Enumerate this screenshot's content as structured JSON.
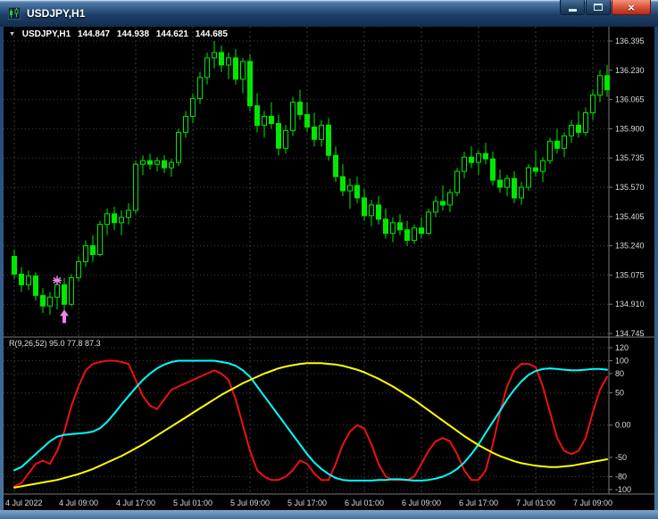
{
  "window": {
    "title": "USDJPY,H1",
    "controls": {
      "close_glyph": "×"
    }
  },
  "info_bar": {
    "dropdown_glyph": "▼",
    "symbol_period": "USDJPY,H1",
    "open": "144.847",
    "high": "144.938",
    "low": "144.621",
    "close": "144.685"
  },
  "price_axis": {
    "labels": [
      "136.395",
      "136.230",
      "136.065",
      "135.900",
      "135.735",
      "135.570",
      "135.405",
      "135.240",
      "135.075",
      "134.910",
      "134.745"
    ]
  },
  "indicator_panel": {
    "label": "R(9,26,52) 95.0 77.8 87.3",
    "axis_labels": [
      "120",
      "100",
      "80",
      "50",
      "0.00",
      "-50",
      "-80",
      "-100"
    ],
    "axis_values": [
      120,
      100,
      80,
      50,
      0,
      -50,
      -80,
      -100
    ]
  },
  "time_axis": {
    "labels": [
      "4 Jul 2022",
      "4 Jul 09:00",
      "4 Jul 17:00",
      "5 Jul 01:00",
      "5 Jul 09:00",
      "5 Jul 17:00",
      "6 Jul 01:00",
      "6 Jul 09:00",
      "6 Jul 17:00",
      "7 Jul 01:00",
      "7 Jul 09:00"
    ],
    "bar_indices": [
      0,
      9,
      17,
      25,
      33,
      41,
      49,
      57,
      65,
      73,
      81
    ]
  },
  "colors": {
    "background": "#000000",
    "grid": "#3c3c3c",
    "frame_line": "#7a7a7a",
    "axis_text": "#dcdcdc",
    "candle": "#00e800",
    "bull_fill": "#000000",
    "indicator_red": "#ee1111",
    "indicator_cyan": "#00ffff",
    "indicator_yellow": "#ffff00",
    "marker": "#ee82ee"
  },
  "chart_data": {
    "type": "candlestick",
    "title": "USDJPY,H1",
    "ylim": [
      134.7,
      136.44
    ],
    "price_gridlines": [
      136.395,
      136.23,
      136.065,
      135.9,
      135.735,
      135.57,
      135.405,
      135.24,
      135.075,
      134.91,
      134.745
    ],
    "candles_ohlc": [
      [
        135.18,
        135.22,
        135.05,
        135.08
      ],
      [
        135.08,
        135.12,
        134.98,
        135.02
      ],
      [
        135.02,
        135.1,
        134.99,
        135.07
      ],
      [
        135.07,
        135.09,
        134.93,
        134.96
      ],
      [
        134.96,
        135.0,
        134.86,
        134.9
      ],
      [
        134.9,
        134.98,
        134.85,
        134.95
      ],
      [
        134.95,
        135.05,
        134.88,
        135.02
      ],
      [
        135.02,
        135.06,
        134.87,
        134.91
      ],
      [
        134.91,
        135.08,
        134.9,
        135.06
      ],
      [
        135.06,
        135.18,
        135.04,
        135.15
      ],
      [
        135.15,
        135.27,
        135.12,
        135.24
      ],
      [
        135.24,
        135.3,
        135.15,
        135.19
      ],
      [
        135.19,
        135.38,
        135.18,
        135.36
      ],
      [
        135.36,
        135.45,
        135.3,
        135.42
      ],
      [
        135.42,
        135.46,
        135.33,
        135.37
      ],
      [
        135.37,
        135.44,
        135.3,
        135.4
      ],
      [
        135.4,
        135.48,
        135.36,
        135.44
      ],
      [
        135.44,
        135.72,
        135.42,
        135.7
      ],
      [
        135.7,
        135.75,
        135.64,
        135.72
      ],
      [
        135.72,
        135.76,
        135.67,
        135.7
      ],
      [
        135.7,
        135.74,
        135.66,
        135.72
      ],
      [
        135.72,
        135.75,
        135.65,
        135.68
      ],
      [
        135.68,
        135.73,
        135.63,
        135.71
      ],
      [
        135.71,
        135.9,
        135.69,
        135.88
      ],
      [
        135.88,
        136.0,
        135.85,
        135.97
      ],
      [
        135.97,
        136.1,
        135.93,
        136.07
      ],
      [
        136.07,
        136.22,
        136.04,
        136.19
      ],
      [
        136.19,
        136.33,
        136.15,
        136.3
      ],
      [
        136.3,
        136.395,
        136.24,
        136.33
      ],
      [
        136.33,
        136.37,
        136.22,
        136.26
      ],
      [
        136.26,
        136.33,
        136.18,
        136.3
      ],
      [
        136.3,
        136.35,
        136.15,
        136.18
      ],
      [
        136.18,
        136.3,
        136.1,
        136.28
      ],
      [
        136.28,
        136.32,
        136.0,
        136.03
      ],
      [
        136.03,
        136.1,
        135.88,
        135.92
      ],
      [
        135.92,
        136.0,
        135.85,
        135.97
      ],
      [
        135.97,
        136.05,
        135.9,
        135.93
      ],
      [
        135.93,
        135.98,
        135.75,
        135.79
      ],
      [
        135.79,
        135.92,
        135.76,
        135.89
      ],
      [
        135.89,
        136.08,
        135.86,
        136.05
      ],
      [
        136.05,
        136.12,
        135.95,
        135.98
      ],
      [
        135.98,
        136.05,
        135.88,
        135.91
      ],
      [
        135.91,
        135.99,
        135.8,
        135.84
      ],
      [
        135.84,
        135.95,
        135.8,
        135.92
      ],
      [
        135.92,
        135.96,
        135.72,
        135.75
      ],
      [
        135.75,
        135.8,
        135.6,
        135.63
      ],
      [
        135.63,
        135.7,
        135.52,
        135.55
      ],
      [
        135.55,
        135.62,
        135.45,
        135.58
      ],
      [
        135.58,
        135.63,
        135.48,
        135.51
      ],
      [
        135.51,
        135.56,
        135.38,
        135.41
      ],
      [
        135.41,
        135.5,
        135.35,
        135.47
      ],
      [
        135.47,
        135.52,
        135.36,
        135.39
      ],
      [
        135.39,
        135.45,
        135.28,
        135.31
      ],
      [
        135.31,
        135.4,
        135.26,
        135.37
      ],
      [
        135.37,
        135.42,
        135.3,
        135.33
      ],
      [
        135.33,
        135.38,
        135.24,
        135.27
      ],
      [
        135.27,
        135.36,
        135.25,
        135.34
      ],
      [
        135.34,
        135.4,
        135.28,
        135.31
      ],
      [
        135.31,
        135.45,
        135.3,
        135.43
      ],
      [
        135.43,
        135.52,
        135.4,
        135.49
      ],
      [
        135.49,
        135.58,
        135.44,
        135.47
      ],
      [
        135.47,
        135.56,
        135.43,
        135.54
      ],
      [
        135.54,
        135.68,
        135.52,
        135.66
      ],
      [
        135.66,
        135.77,
        135.62,
        135.74
      ],
      [
        135.74,
        135.8,
        135.68,
        135.71
      ],
      [
        135.71,
        135.78,
        135.64,
        135.76
      ],
      [
        135.76,
        135.82,
        135.7,
        135.73
      ],
      [
        135.73,
        135.77,
        135.58,
        135.61
      ],
      [
        135.61,
        135.67,
        135.54,
        135.57
      ],
      [
        135.57,
        135.64,
        135.52,
        135.62
      ],
      [
        135.62,
        135.66,
        135.48,
        135.51
      ],
      [
        135.51,
        135.6,
        135.47,
        135.57
      ],
      [
        135.57,
        135.7,
        135.55,
        135.68
      ],
      [
        135.68,
        135.78,
        135.63,
        135.66
      ],
      [
        135.66,
        135.74,
        135.6,
        135.72
      ],
      [
        135.72,
        135.85,
        135.7,
        135.83
      ],
      [
        135.83,
        135.9,
        135.76,
        135.79
      ],
      [
        135.79,
        135.88,
        135.74,
        135.86
      ],
      [
        135.86,
        135.95,
        135.82,
        135.92
      ],
      [
        135.92,
        136.0,
        135.85,
        135.88
      ],
      [
        135.88,
        136.02,
        135.86,
        135.99
      ],
      [
        135.99,
        136.12,
        135.95,
        136.09
      ],
      [
        136.09,
        136.23,
        136.05,
        136.2
      ],
      [
        136.2,
        136.26,
        136.08,
        136.12
      ]
    ],
    "markers": [
      {
        "type": "star",
        "bar": 6,
        "price": 135.045
      },
      {
        "type": "arrow-up",
        "bar": 7,
        "price": 134.9
      }
    ],
    "indicator": {
      "name": "R(9,26,52)",
      "values_display": [
        "95.0",
        "77.8",
        "87.3"
      ],
      "range": [
        -100,
        120
      ],
      "series": [
        {
          "name": "R9",
          "color_key": "indicator_red",
          "values": [
            -95,
            -90,
            -75,
            -60,
            -55,
            -60,
            -40,
            -10,
            30,
            60,
            85,
            95,
            98,
            100,
            100,
            98,
            95,
            70,
            45,
            30,
            25,
            40,
            55,
            60,
            65,
            70,
            75,
            80,
            85,
            80,
            70,
            40,
            0,
            -40,
            -70,
            -80,
            -85,
            -85,
            -80,
            -70,
            -55,
            -60,
            -75,
            -85,
            -85,
            -60,
            -30,
            -10,
            0,
            -5,
            -30,
            -60,
            -80,
            -85,
            -85,
            -85,
            -80,
            -60,
            -40,
            -25,
            -20,
            -25,
            -45,
            -70,
            -85,
            -85,
            -70,
            -30,
            20,
            60,
            85,
            95,
            95,
            90,
            60,
            20,
            -20,
            -40,
            -45,
            -40,
            -20,
            20,
            55,
            75
          ]
        },
        {
          "name": "R26",
          "color_key": "indicator_cyan",
          "values": [
            -70,
            -65,
            -55,
            -45,
            -35,
            -25,
            -18,
            -15,
            -14,
            -13,
            -12,
            -10,
            -5,
            5,
            18,
            32,
            45,
            58,
            70,
            80,
            88,
            94,
            98,
            100,
            100,
            100,
            100,
            100,
            100,
            98,
            96,
            92,
            85,
            75,
            60,
            45,
            30,
            15,
            0,
            -15,
            -30,
            -45,
            -58,
            -68,
            -76,
            -82,
            -85,
            -86,
            -86,
            -86,
            -86,
            -85,
            -85,
            -84,
            -84,
            -85,
            -86,
            -86,
            -85,
            -83,
            -80,
            -75,
            -68,
            -58,
            -45,
            -30,
            -12,
            5,
            22,
            40,
            55,
            68,
            78,
            84,
            87,
            88,
            87,
            86,
            85,
            85,
            86,
            87,
            87,
            86
          ]
        },
        {
          "name": "R52",
          "color_key": "indicator_yellow",
          "values": [
            -97,
            -95,
            -93,
            -91,
            -89,
            -87,
            -85,
            -82,
            -79,
            -76,
            -72,
            -68,
            -63,
            -58,
            -53,
            -48,
            -42,
            -36,
            -30,
            -23,
            -16,
            -9,
            -2,
            5,
            12,
            19,
            26,
            33,
            40,
            47,
            53,
            59,
            65,
            70,
            75,
            80,
            84,
            88,
            91,
            93,
            95,
            96,
            96,
            96,
            95,
            94,
            92,
            89,
            86,
            82,
            77,
            72,
            66,
            60,
            53,
            46,
            39,
            31,
            23,
            15,
            7,
            -1,
            -9,
            -17,
            -24,
            -31,
            -37,
            -43,
            -48,
            -52,
            -56,
            -59,
            -61,
            -63,
            -64,
            -65,
            -65,
            -64,
            -63,
            -61,
            -59,
            -57,
            -55,
            -53
          ]
        }
      ]
    }
  }
}
